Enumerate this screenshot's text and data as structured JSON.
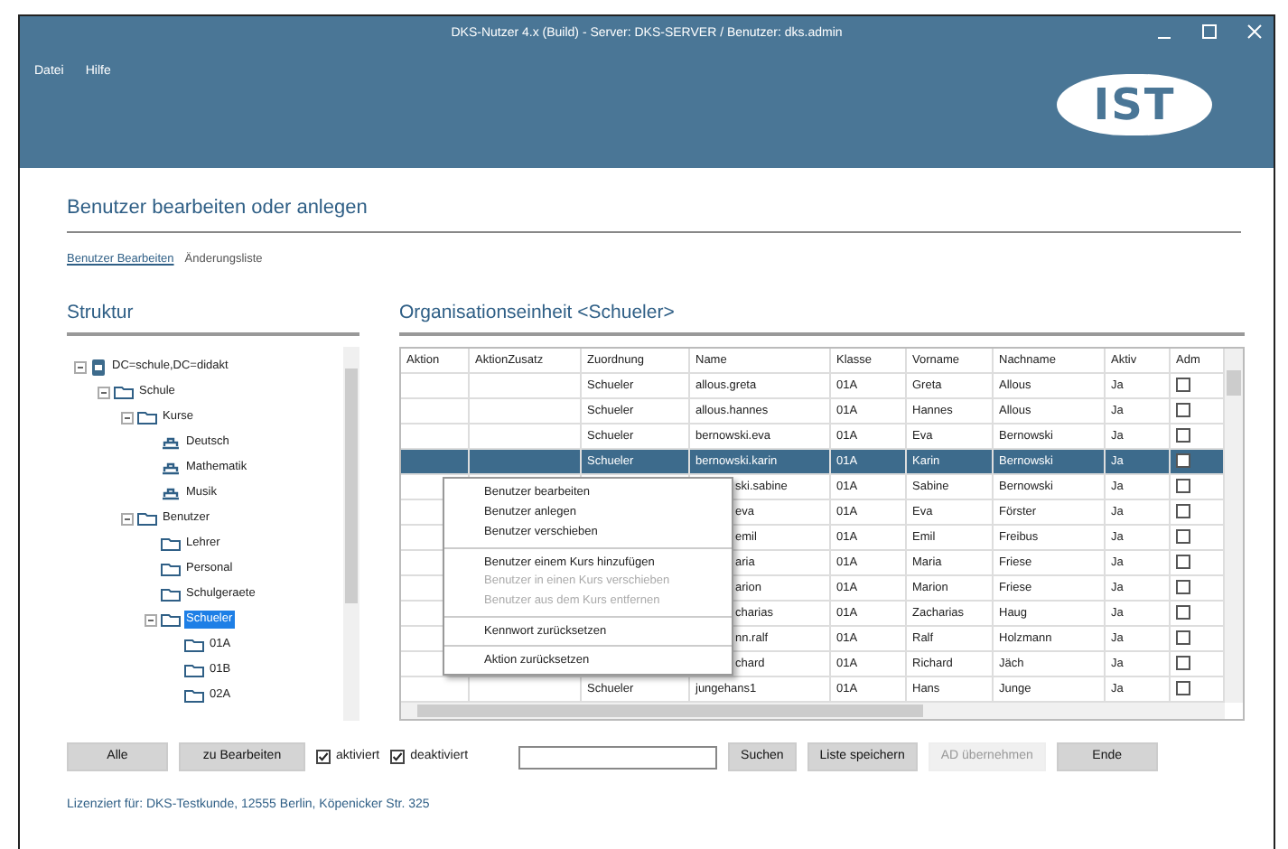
{
  "window": {
    "title": "DKS-Nutzer 4.x (Build) - Server: DKS-SERVER / Benutzer: dks.admin",
    "logo": "IST"
  },
  "menu": [
    "Datei",
    "Hilfe"
  ],
  "page_title": "Benutzer bearbeiten oder anlegen",
  "links": [
    {
      "label": "Benutzer Bearbeiten",
      "selected": true
    },
    {
      "label": "Änderungsliste",
      "selected": false
    }
  ],
  "tree": {
    "title": "Struktur",
    "items": [
      {
        "label": "DC=schule,DC=didakt",
        "kind": "server",
        "expanded": true,
        "selected": false,
        "children": [
          {
            "label": "Schule",
            "kind": "folder",
            "expanded": true,
            "selected": false,
            "children": [
              {
                "label": "Kurse",
                "kind": "folder",
                "expanded": true,
                "selected": false,
                "children": [
                  {
                    "label": "Deutsch",
                    "kind": "group",
                    "selected": false
                  },
                  {
                    "label": "Mathematik",
                    "kind": "group",
                    "selected": false
                  },
                  {
                    "label": "Musik",
                    "kind": "group",
                    "selected": false
                  }
                ]
              },
              {
                "label": "Benutzer",
                "kind": "folder",
                "expanded": true,
                "selected": false,
                "children": [
                  {
                    "label": "Lehrer",
                    "kind": "folder",
                    "selected": false
                  },
                  {
                    "label": "Personal",
                    "kind": "folder",
                    "selected": false
                  },
                  {
                    "label": "Schulgeraete",
                    "kind": "folder",
                    "selected": false
                  },
                  {
                    "label": "Schueler",
                    "kind": "folder",
                    "expanded": true,
                    "selected": true,
                    "children": [
                      {
                        "label": "01A",
                        "kind": "folder",
                        "selected": false
                      },
                      {
                        "label": "01B",
                        "kind": "folder",
                        "selected": false
                      },
                      {
                        "label": "02A",
                        "kind": "folder",
                        "selected": false
                      }
                    ]
                  }
                ]
              }
            ]
          }
        ]
      }
    ]
  },
  "table": {
    "title": "Organisationseinheit <Schueler>",
    "columns": [
      "Aktion",
      "AktionZusatz",
      "Zuordnung",
      "Name",
      "Klasse",
      "Vorname",
      "Nachname",
      "Aktiv",
      "Adm"
    ],
    "rows": [
      {
        "zuordnung": "Schueler",
        "name": "allous.greta",
        "klasse": "01A",
        "vorname": "Greta",
        "nachname": "Allous",
        "aktiv": "Ja",
        "admin": false,
        "selected": false,
        "covered": false
      },
      {
        "zuordnung": "Schueler",
        "name": "allous.hannes",
        "klasse": "01A",
        "vorname": "Hannes",
        "nachname": "Allous",
        "aktiv": "Ja",
        "admin": false,
        "selected": false,
        "covered": false
      },
      {
        "zuordnung": "Schueler",
        "name": "bernowski.eva",
        "klasse": "01A",
        "vorname": "Eva",
        "nachname": "Bernowski",
        "aktiv": "Ja",
        "admin": false,
        "selected": false,
        "covered": false
      },
      {
        "zuordnung": "Schueler",
        "name": "bernowski.karin",
        "klasse": "01A",
        "vorname": "Karin",
        "nachname": "Bernowski",
        "aktiv": "Ja",
        "admin": false,
        "selected": true,
        "covered": false
      },
      {
        "name": "ski.sabine",
        "klasse": "01A",
        "vorname": "Sabine",
        "nachname": "Bernowski",
        "aktiv": "Ja",
        "admin": false,
        "selected": false,
        "covered": true
      },
      {
        "name": "eva",
        "klasse": "01A",
        "vorname": "Eva",
        "nachname": "Förster",
        "aktiv": "Ja",
        "admin": false,
        "selected": false,
        "covered": true
      },
      {
        "name": "emil",
        "klasse": "01A",
        "vorname": "Emil",
        "nachname": "Freibus",
        "aktiv": "Ja",
        "admin": false,
        "selected": false,
        "covered": true
      },
      {
        "name": "aria",
        "klasse": "01A",
        "vorname": "Maria",
        "nachname": "Friese",
        "aktiv": "Ja",
        "admin": false,
        "selected": false,
        "covered": true
      },
      {
        "name": "arion",
        "klasse": "01A",
        "vorname": "Marion",
        "nachname": "Friese",
        "aktiv": "Ja",
        "admin": false,
        "selected": false,
        "covered": true
      },
      {
        "name": "charias",
        "klasse": "01A",
        "vorname": "Zacharias",
        "nachname": "Haug",
        "aktiv": "Ja",
        "admin": false,
        "selected": false,
        "covered": true
      },
      {
        "name": "nn.ralf",
        "klasse": "01A",
        "vorname": "Ralf",
        "nachname": "Holzmann",
        "aktiv": "Ja",
        "admin": false,
        "selected": false,
        "covered": true
      },
      {
        "name": "chard",
        "klasse": "01A",
        "vorname": "Richard",
        "nachname": "Jäch",
        "aktiv": "Ja",
        "admin": false,
        "selected": false,
        "covered": true
      },
      {
        "zuordnung": "Schueler",
        "name": "jungehans1",
        "klasse": "01A",
        "vorname": "Hans",
        "nachname": "Junge",
        "aktiv": "Ja",
        "admin": false,
        "selected": false,
        "covered": false
      }
    ]
  },
  "context_menu": [
    {
      "label": "Benutzer bearbeiten",
      "disabled": false,
      "divider_before": false
    },
    {
      "label": "Benutzer anlegen",
      "disabled": false,
      "divider_before": false
    },
    {
      "label": "Benutzer verschieben",
      "disabled": false,
      "divider_before": false
    },
    {
      "label": "Benutzer einem Kurs hinzufügen",
      "disabled": false,
      "divider_before": true
    },
    {
      "label": "Benutzer in einen Kurs verschieben",
      "disabled": true,
      "divider_before": false
    },
    {
      "label": "Benutzer aus dem Kurs entfernen",
      "disabled": true,
      "divider_before": false
    },
    {
      "label": "Kennwort zurücksetzen",
      "disabled": false,
      "divider_before": true
    },
    {
      "label": "Aktion zurücksetzen",
      "disabled": false,
      "divider_before": true
    }
  ],
  "toolbar": [
    {
      "kind": "button",
      "label": "Alle",
      "disabled": false
    },
    {
      "kind": "button",
      "label": "zu Bearbeiten",
      "disabled": false
    },
    {
      "kind": "checkbox",
      "label": "aktiviert",
      "checked": true
    },
    {
      "kind": "checkbox",
      "label": "deaktiviert",
      "checked": true
    },
    {
      "kind": "search"
    },
    {
      "kind": "button",
      "label": "Suchen",
      "disabled": false
    },
    {
      "kind": "button",
      "label": "Liste speichern",
      "disabled": false
    },
    {
      "kind": "button",
      "label": "AD übernehmen",
      "disabled": true
    },
    {
      "kind": "button",
      "label": "Ende",
      "disabled": false
    }
  ],
  "footer": "Lizenziert für: DKS-Testkunde, 12555 Berlin, Köpenicker Str. 325"
}
